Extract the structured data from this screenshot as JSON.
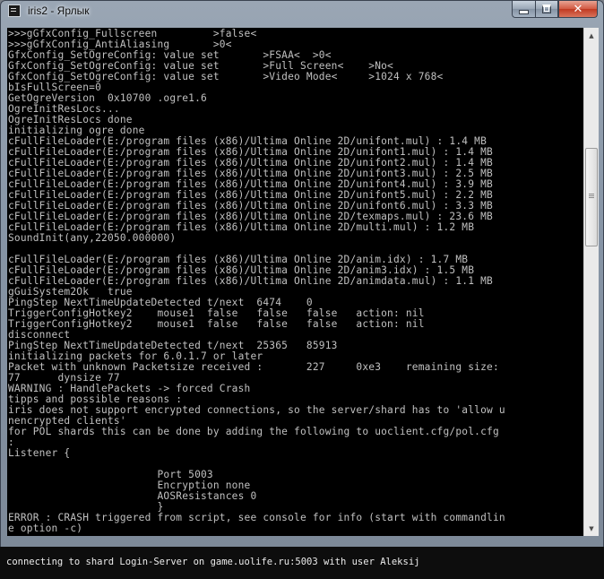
{
  "window": {
    "title": "iris2 - Ярлык"
  },
  "console": {
    "lines": [
      ">>>gGfxConfig_Fullscreen         >false<",
      ">>>gGfxConfig_AntiAliasing       >0<",
      "GfxConfig_SetOgreConfig: value set       >FSAA<  >0<",
      "GfxConfig_SetOgreConfig: value set       >Full Screen<    >No<",
      "GfxConfig_SetOgreConfig: value set       >Video Mode<     >1024 x 768<",
      "bIsFullScreen=0",
      "GetOgreVersion  0x10700 .ogre1.6",
      "OgreInitResLocs...",
      "OgreInitResLocs done",
      "initializing ogre done",
      "cFullFileLoader(E:/program files (x86)/Ultima Online 2D/unifont.mul) : 1.4 MB",
      "cFullFileLoader(E:/program files (x86)/Ultima Online 2D/unifont1.mul) : 1.4 MB",
      "cFullFileLoader(E:/program files (x86)/Ultima Online 2D/unifont2.mul) : 1.4 MB",
      "cFullFileLoader(E:/program files (x86)/Ultima Online 2D/unifont3.mul) : 2.5 MB",
      "cFullFileLoader(E:/program files (x86)/Ultima Online 2D/unifont4.mul) : 3.9 MB",
      "cFullFileLoader(E:/program files (x86)/Ultima Online 2D/unifont5.mul) : 2.2 MB",
      "cFullFileLoader(E:/program files (x86)/Ultima Online 2D/unifont6.mul) : 3.3 MB",
      "cFullFileLoader(E:/program files (x86)/Ultima Online 2D/texmaps.mul) : 23.6 MB",
      "cFullFileLoader(E:/program files (x86)/Ultima Online 2D/multi.mul) : 1.2 MB",
      "SoundInit(any,22050.000000)",
      "",
      "cFullFileLoader(E:/program files (x86)/Ultima Online 2D/anim.idx) : 1.7 MB",
      "cFullFileLoader(E:/program files (x86)/Ultima Online 2D/anim3.idx) : 1.5 MB",
      "cFullFileLoader(E:/program files (x86)/Ultima Online 2D/animdata.mul) : 1.1 MB",
      "gGuiSystem2Ok   true",
      "PingStep NextTimeUpdateDetected t/next  6474    0",
      "TriggerConfigHotkey2    mouse1  false   false   false   action: nil",
      "TriggerConfigHotkey2    mouse1  false   false   false   action: nil",
      "disconnect",
      "PingStep NextTimeUpdateDetected t/next  25365   85913",
      "initializing packets for 6.0.1.7 or later",
      "Packet with unknown Packetsize received :       227     0xe3    remaining size:",
      "77      dynsize 77",
      "WARNING : HandlePackets -> forced Crash",
      "tipps and possible reasons :",
      "iris does not support encrypted connections, so the server/shard has to 'allow u",
      "nencrypted clients'",
      "for POL shards this can be done by adding the following to uoclient.cfg/pol.cfg",
      ":",
      "Listener {",
      "",
      "                        Port 5003",
      "                        Encryption none",
      "                        AOSResistances 0",
      "                        }",
      "ERROR : CRASH triggered from script, see console for info (start with commandlin",
      "e option -c)"
    ]
  },
  "status": {
    "text": "connecting to shard Login-Server on game.uolife.ru:5003 with user Aleksij"
  }
}
